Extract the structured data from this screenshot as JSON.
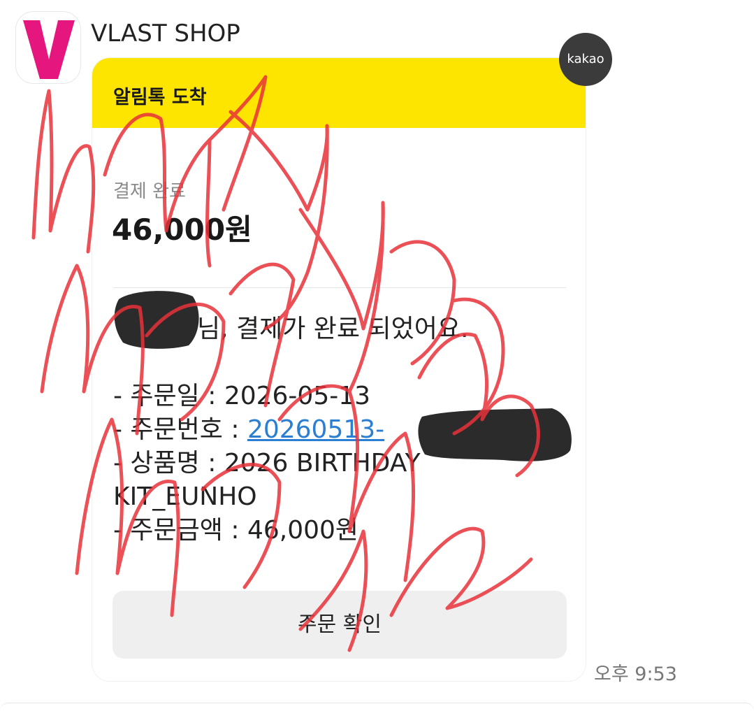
{
  "sender": {
    "name": "VLAST SHOP",
    "avatar_icon": "vlast-v-logo-icon",
    "avatar_color": "#e5177f"
  },
  "badge": {
    "label": "kakao",
    "color": "#3b3b3b"
  },
  "message": {
    "header_title": "알림톡 도착",
    "header_color": "#fee500",
    "payment_label": "결제 완료",
    "payment_amount": "46,000원",
    "greeting": "님, 결제가 완료 되었어요.",
    "details": [
      {
        "label": "- 주문일 : ",
        "value": "2026-05-13"
      },
      {
        "label": "- 주문번호 : ",
        "value": "20260513-"
      },
      {
        "label": "- 상품명 : ",
        "value": "2026 BIRTHDAY",
        "continuation": "KIT_EUNHO"
      },
      {
        "label": "- 주문금액 : ",
        "value": "46,000원"
      }
    ],
    "link_color": "#2a7fd3",
    "button_label": "주문 확인",
    "time": "오후 9:53"
  },
  "redaction": {
    "color": "#2b2b2b"
  },
  "scribble": {
    "color": "#e8323a",
    "icon": "handwritten-watermark-scribble"
  }
}
